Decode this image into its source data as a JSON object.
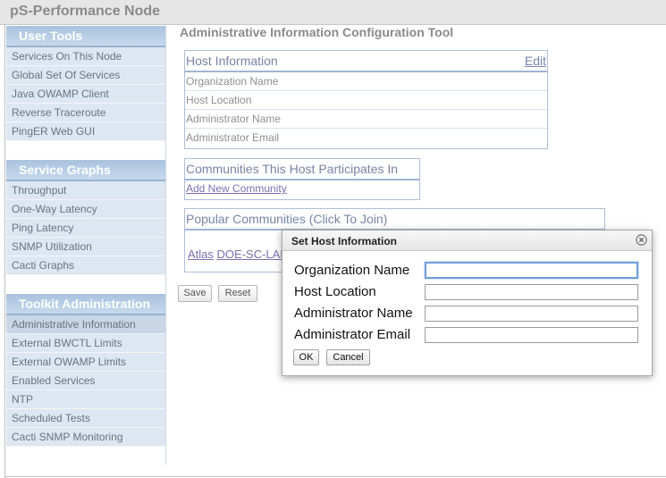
{
  "app": {
    "title": "pS-Performance Node"
  },
  "sidebar": {
    "sections": [
      {
        "title": "User Tools",
        "items": [
          "Services On This Node",
          "Global Set Of Services",
          "Java OWAMP Client",
          "Reverse Traceroute",
          "PingER Web GUI"
        ]
      },
      {
        "title": "Service Graphs",
        "items": [
          "Throughput",
          "One-Way Latency",
          "Ping Latency",
          "SNMP Utilization",
          "Cacti Graphs"
        ]
      },
      {
        "title": "Toolkit Administration",
        "items": [
          "Administrative Information",
          "External BWCTL Limits",
          "External OWAMP Limits",
          "Enabled Services",
          "NTP",
          "Scheduled Tests",
          "Cacti SNMP Monitoring"
        ]
      }
    ],
    "active_item": "Administrative Information"
  },
  "main": {
    "title": "Administrative Information Configuration Tool",
    "host_info": {
      "title": "Host Information",
      "edit_label": "Edit",
      "rows": [
        "Organization Name",
        "Host Location",
        "Administrator Name",
        "Administrator Email"
      ]
    },
    "communities": {
      "title": "Communities This Host Participates In",
      "add_label": "Add New Community"
    },
    "popular": {
      "title": "Popular Communities (Click To Join)",
      "links": [
        "Atlas",
        "DOE-SC-LAB"
      ]
    },
    "buttons": {
      "save": "Save",
      "reset": "Reset"
    }
  },
  "dialog": {
    "title": "Set Host Information",
    "fields": [
      {
        "label": "Organization Name",
        "value": ""
      },
      {
        "label": "Host Location",
        "value": ""
      },
      {
        "label": "Administrator Name",
        "value": ""
      },
      {
        "label": "Administrator Email",
        "value": ""
      }
    ],
    "ok_label": "OK",
    "cancel_label": "Cancel"
  },
  "colors": {
    "accent": "#9bb4d1",
    "sidebar_bg": "#dde7f2",
    "link": "#7c6fb0"
  }
}
